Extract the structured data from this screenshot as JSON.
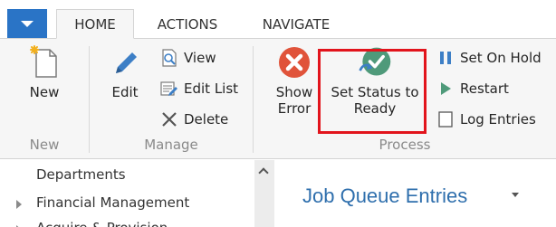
{
  "tabs": [
    {
      "label": "HOME",
      "active": true
    },
    {
      "label": "ACTIONS",
      "active": false
    },
    {
      "label": "NAVIGATE",
      "active": false
    }
  ],
  "ribbon": {
    "groups": {
      "new": {
        "label": "New",
        "buttons": {
          "new": {
            "label": "New",
            "icon": "new-document-icon"
          }
        }
      },
      "manage": {
        "label": "Manage",
        "buttons": {
          "edit": {
            "label": "Edit",
            "icon": "pencil-icon"
          },
          "view": {
            "label": "View",
            "icon": "view-icon"
          },
          "edit_list": {
            "label": "Edit List",
            "icon": "edit-list-icon"
          },
          "delete": {
            "label": "Delete",
            "icon": "delete-x-icon"
          }
        }
      },
      "process": {
        "label": "Process",
        "buttons": {
          "show_error": {
            "line1": "Show",
            "line2": "Error",
            "icon": "error-x-circle-icon"
          },
          "set_status": {
            "line1": "Set Status to",
            "line2": "Ready",
            "icon": "set-status-ready-icon"
          },
          "set_on_hold": {
            "label": "Set On Hold",
            "icon": "pause-icon"
          },
          "restart": {
            "label": "Restart",
            "icon": "play-icon"
          },
          "log_entries": {
            "label": "Log Entries",
            "icon": "log-entries-icon"
          }
        }
      }
    }
  },
  "nav": {
    "items": [
      "Departments",
      "Financial Management",
      "Acquire & Provision"
    ]
  },
  "page": {
    "title": "Job Queue Entries"
  },
  "colors": {
    "app_menu": "#2a74c6",
    "error_red": "#e0533a",
    "status_green": "#4f9a7a",
    "highlight": "#e2141c",
    "title_blue": "#2f6fad"
  }
}
